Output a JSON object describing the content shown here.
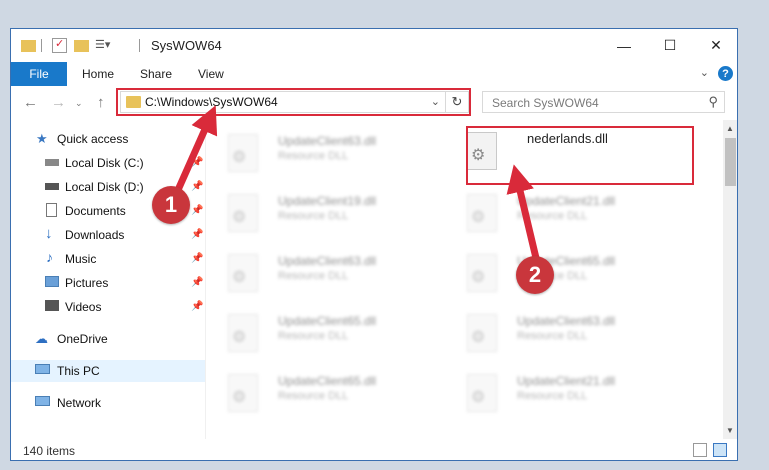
{
  "window": {
    "title": "SysWOW64"
  },
  "ribbon": {
    "file": "File",
    "tabs": [
      "Home",
      "Share",
      "View"
    ],
    "help": "?"
  },
  "address": {
    "path": "C:\\Windows\\SysWOW64"
  },
  "search": {
    "placeholder": "Search SysWOW64"
  },
  "nav": {
    "quick_access": "Quick access",
    "items": [
      "Local Disk (C:)",
      "Local Disk (D:)",
      "Documents",
      "Downloads",
      "Music",
      "Pictures",
      "Videos"
    ],
    "onedrive": "OneDrive",
    "thispc": "This PC",
    "network": "Network"
  },
  "files": [
    {
      "name": "UpdateClient63.dll",
      "type": "Resource DLL"
    },
    {
      "name": "nederlands.dll",
      "type": ""
    },
    {
      "name": "UpdateClient19.dll",
      "type": "Resource DLL"
    },
    {
      "name": "UpdateClient21.dll",
      "type": "Resource DLL"
    },
    {
      "name": "UpdateClient63.dll",
      "type": "Resource DLL"
    },
    {
      "name": "UpdateClient65.dll",
      "type": "Resource DLL"
    },
    {
      "name": "UpdateClient65.dll",
      "type": "Resource DLL"
    },
    {
      "name": "UpdateClient63.dll",
      "type": "Resource DLL"
    },
    {
      "name": "UpdateClient65.dll",
      "type": "Resource DLL"
    },
    {
      "name": "UpdateClient21.dll",
      "type": "Resource DLL"
    }
  ],
  "status": {
    "count": "140 items"
  },
  "callouts": [
    "1",
    "2"
  ],
  "colors": {
    "accent": "#1979ca",
    "highlight": "#d92a3a",
    "callout": "#c9363c"
  }
}
